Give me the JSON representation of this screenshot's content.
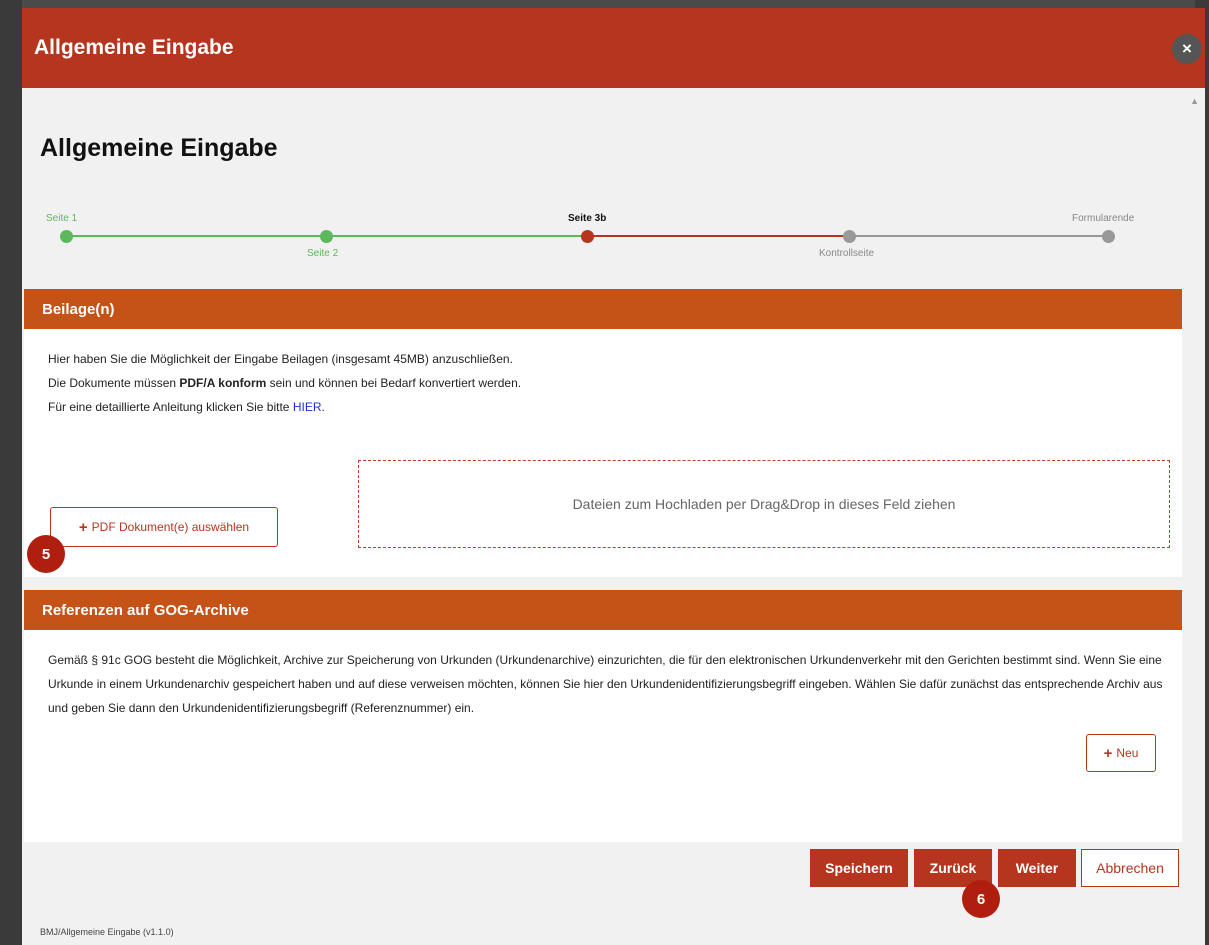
{
  "modal": {
    "title": "Allgemeine Eingabe",
    "close_glyph": "×",
    "scroll_glyph": "▲"
  },
  "page_title": "Allgemeine Eingabe",
  "stepper": {
    "steps": [
      {
        "label": "Seite 1",
        "state": "done"
      },
      {
        "label": "Seite 2",
        "state": "done"
      },
      {
        "label": "Seite 3b",
        "state": "current"
      },
      {
        "label": "Kontrollseite",
        "state": "pending"
      },
      {
        "label": "Formularende",
        "state": "pending"
      }
    ],
    "colors": {
      "done": "#5cb85c",
      "current": "#b5351f",
      "pending": "#999999"
    }
  },
  "beilagen": {
    "header": "Beilage(n)",
    "line1": "Hier haben Sie die Möglichkeit der Eingabe Beilagen (insgesamt 45MB) anzuschließen.",
    "line2_prefix": "Die Dokumente müssen ",
    "line2_bold": "PDF/A konform",
    "line2_suffix": " sein und können bei Bedarf konvertiert werden.",
    "line3_prefix": "Für eine detaillierte Anleitung klicken Sie bitte ",
    "line3_link": "HIER",
    "line3_suffix": ".",
    "pdf_button_icon": "plus-icon",
    "pdf_button_label": "PDF Dokument(e) auswählen",
    "dropzone_text": "Dateien zum Hochladen per Drag&Drop in dieses Feld ziehen"
  },
  "referenzen": {
    "header": "Referenzen auf GOG-Archive",
    "text": "Gemäß § 91c GOG besteht die Möglichkeit, Archive zur Speicherung von Urkunden (Urkundenarchive) einzurichten, die für den elektronischen Urkundenverkehr mit den Gerichten bestimmt sind. Wenn Sie eine Urkunde in einem Urkundenarchiv gespeichert haben und auf diese verweisen möchten, können Sie hier den Urkundenidentifizierungsbegriff eingeben. Wählen Sie dafür zunächst das entsprechende Archiv aus und geben Sie dann den Urkundenidentifizierungsbegriff (Referenznummer) ein.",
    "new_button_label": "Neu"
  },
  "footer": {
    "speichern": "Speichern",
    "zurueck": "Zurück",
    "weiter": "Weiter",
    "abbrechen": "Abbrechen",
    "version": "BMJ/Allgemeine Eingabe (v1.1.0)"
  },
  "badges": {
    "badge5": "5",
    "badge6": "6"
  },
  "colors": {
    "header_red": "#b5351f",
    "section_orange": "#c55217",
    "badge_red": "#b01e10"
  }
}
